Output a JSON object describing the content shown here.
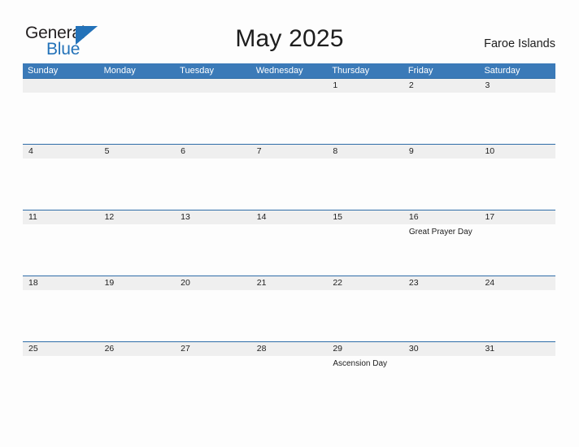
{
  "brand": {
    "name_part1": "General",
    "name_part2": "Blue",
    "triangle_color": "#2372b9",
    "text_color": "#231f20"
  },
  "header": {
    "title": "May 2025",
    "region": "Faroe Islands"
  },
  "colors": {
    "weekday_header_bg": "#3b7ab8",
    "weekday_header_text": "#ffffff",
    "week_row_border": "#2f6da8",
    "date_band_bg": "#efefef",
    "page_bg": "#fdfdfd",
    "text": "#1d1d1d"
  },
  "calendar": {
    "weekdays": [
      "Sunday",
      "Monday",
      "Tuesday",
      "Wednesday",
      "Thursday",
      "Friday",
      "Saturday"
    ],
    "weeks": [
      {
        "days": [
          {
            "date": "",
            "event": ""
          },
          {
            "date": "",
            "event": ""
          },
          {
            "date": "",
            "event": ""
          },
          {
            "date": "",
            "event": ""
          },
          {
            "date": "1",
            "event": ""
          },
          {
            "date": "2",
            "event": ""
          },
          {
            "date": "3",
            "event": ""
          }
        ]
      },
      {
        "days": [
          {
            "date": "4",
            "event": ""
          },
          {
            "date": "5",
            "event": ""
          },
          {
            "date": "6",
            "event": ""
          },
          {
            "date": "7",
            "event": ""
          },
          {
            "date": "8",
            "event": ""
          },
          {
            "date": "9",
            "event": ""
          },
          {
            "date": "10",
            "event": ""
          }
        ]
      },
      {
        "days": [
          {
            "date": "11",
            "event": ""
          },
          {
            "date": "12",
            "event": ""
          },
          {
            "date": "13",
            "event": ""
          },
          {
            "date": "14",
            "event": ""
          },
          {
            "date": "15",
            "event": ""
          },
          {
            "date": "16",
            "event": "Great Prayer Day"
          },
          {
            "date": "17",
            "event": ""
          }
        ]
      },
      {
        "days": [
          {
            "date": "18",
            "event": ""
          },
          {
            "date": "19",
            "event": ""
          },
          {
            "date": "20",
            "event": ""
          },
          {
            "date": "21",
            "event": ""
          },
          {
            "date": "22",
            "event": ""
          },
          {
            "date": "23",
            "event": ""
          },
          {
            "date": "24",
            "event": ""
          }
        ]
      },
      {
        "days": [
          {
            "date": "25",
            "event": ""
          },
          {
            "date": "26",
            "event": ""
          },
          {
            "date": "27",
            "event": ""
          },
          {
            "date": "28",
            "event": ""
          },
          {
            "date": "29",
            "event": "Ascension Day"
          },
          {
            "date": "30",
            "event": ""
          },
          {
            "date": "31",
            "event": ""
          }
        ]
      }
    ]
  }
}
